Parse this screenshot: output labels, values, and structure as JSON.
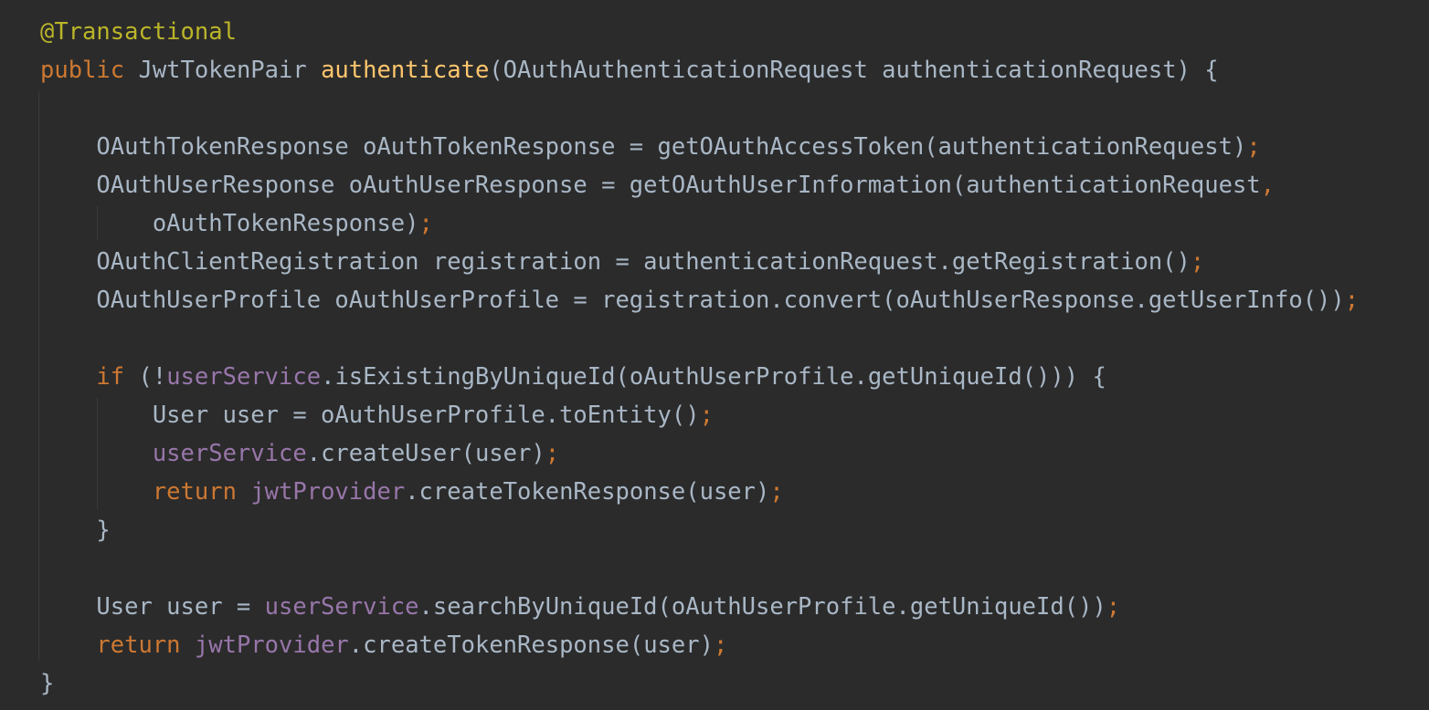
{
  "editor": {
    "language": "java",
    "colors": {
      "background": "#2b2b2b",
      "plain": "#a9b7c6",
      "keyword": "#cc7832",
      "annotation": "#bbb529",
      "method_declaration": "#ffc66d",
      "field": "#9876aa",
      "indent_guide": "#3b3b3b"
    },
    "lines": [
      [
        {
          "t": "@Transactional",
          "c": "an"
        }
      ],
      [
        {
          "t": "public",
          "c": "kw"
        },
        {
          "t": " JwtTokenPair ",
          "c": "pl"
        },
        {
          "t": "authenticate",
          "c": "fn"
        },
        {
          "t": "(OAuthAuthenticationRequest authenticationRequest) {",
          "c": "pl"
        }
      ],
      [],
      [
        {
          "t": "    OAuthTokenResponse oAuthTokenResponse = getOAuthAccessToken(authenticationRequest)",
          "c": "pl"
        },
        {
          "t": ";",
          "c": "kw"
        }
      ],
      [
        {
          "t": "    OAuthUserResponse oAuthUserResponse = getOAuthUserInformation(authenticationRequest",
          "c": "pl"
        },
        {
          "t": ",",
          "c": "kw"
        }
      ],
      [
        {
          "t": "        oAuthTokenResponse)",
          "c": "pl"
        },
        {
          "t": ";",
          "c": "kw"
        }
      ],
      [
        {
          "t": "    OAuthClientRegistration registration = authenticationRequest.getRegistration()",
          "c": "pl"
        },
        {
          "t": ";",
          "c": "kw"
        }
      ],
      [
        {
          "t": "    OAuthUserProfile oAuthUserProfile = registration.convert(oAuthUserResponse.getUserInfo())",
          "c": "pl"
        },
        {
          "t": ";",
          "c": "kw"
        }
      ],
      [],
      [
        {
          "t": "    ",
          "c": "pl"
        },
        {
          "t": "if",
          "c": "kw"
        },
        {
          "t": " (!",
          "c": "pl"
        },
        {
          "t": "userService",
          "c": "fld"
        },
        {
          "t": ".isExistingByUniqueId(oAuthUserProfile.getUniqueId())) {",
          "c": "pl"
        }
      ],
      [
        {
          "t": "        User user = oAuthUserProfile.toEntity()",
          "c": "pl"
        },
        {
          "t": ";",
          "c": "kw"
        }
      ],
      [
        {
          "t": "        ",
          "c": "pl"
        },
        {
          "t": "userService",
          "c": "fld"
        },
        {
          "t": ".createUser(user)",
          "c": "pl"
        },
        {
          "t": ";",
          "c": "kw"
        }
      ],
      [
        {
          "t": "        ",
          "c": "pl"
        },
        {
          "t": "return",
          "c": "kw"
        },
        {
          "t": " ",
          "c": "pl"
        },
        {
          "t": "jwtProvider",
          "c": "fld"
        },
        {
          "t": ".createTokenResponse(user)",
          "c": "pl"
        },
        {
          "t": ";",
          "c": "kw"
        }
      ],
      [
        {
          "t": "    }",
          "c": "pl"
        }
      ],
      [],
      [
        {
          "t": "    User user = ",
          "c": "pl"
        },
        {
          "t": "userService",
          "c": "fld"
        },
        {
          "t": ".searchByUniqueId(oAuthUserProfile.getUniqueId())",
          "c": "pl"
        },
        {
          "t": ";",
          "c": "kw"
        }
      ],
      [
        {
          "t": "    ",
          "c": "pl"
        },
        {
          "t": "return",
          "c": "kw"
        },
        {
          "t": " ",
          "c": "pl"
        },
        {
          "t": "jwtProvider",
          "c": "fld"
        },
        {
          "t": ".createTokenResponse(user)",
          "c": "pl"
        },
        {
          "t": ";",
          "c": "kw"
        }
      ],
      [
        {
          "t": "}",
          "c": "pl"
        }
      ]
    ]
  }
}
